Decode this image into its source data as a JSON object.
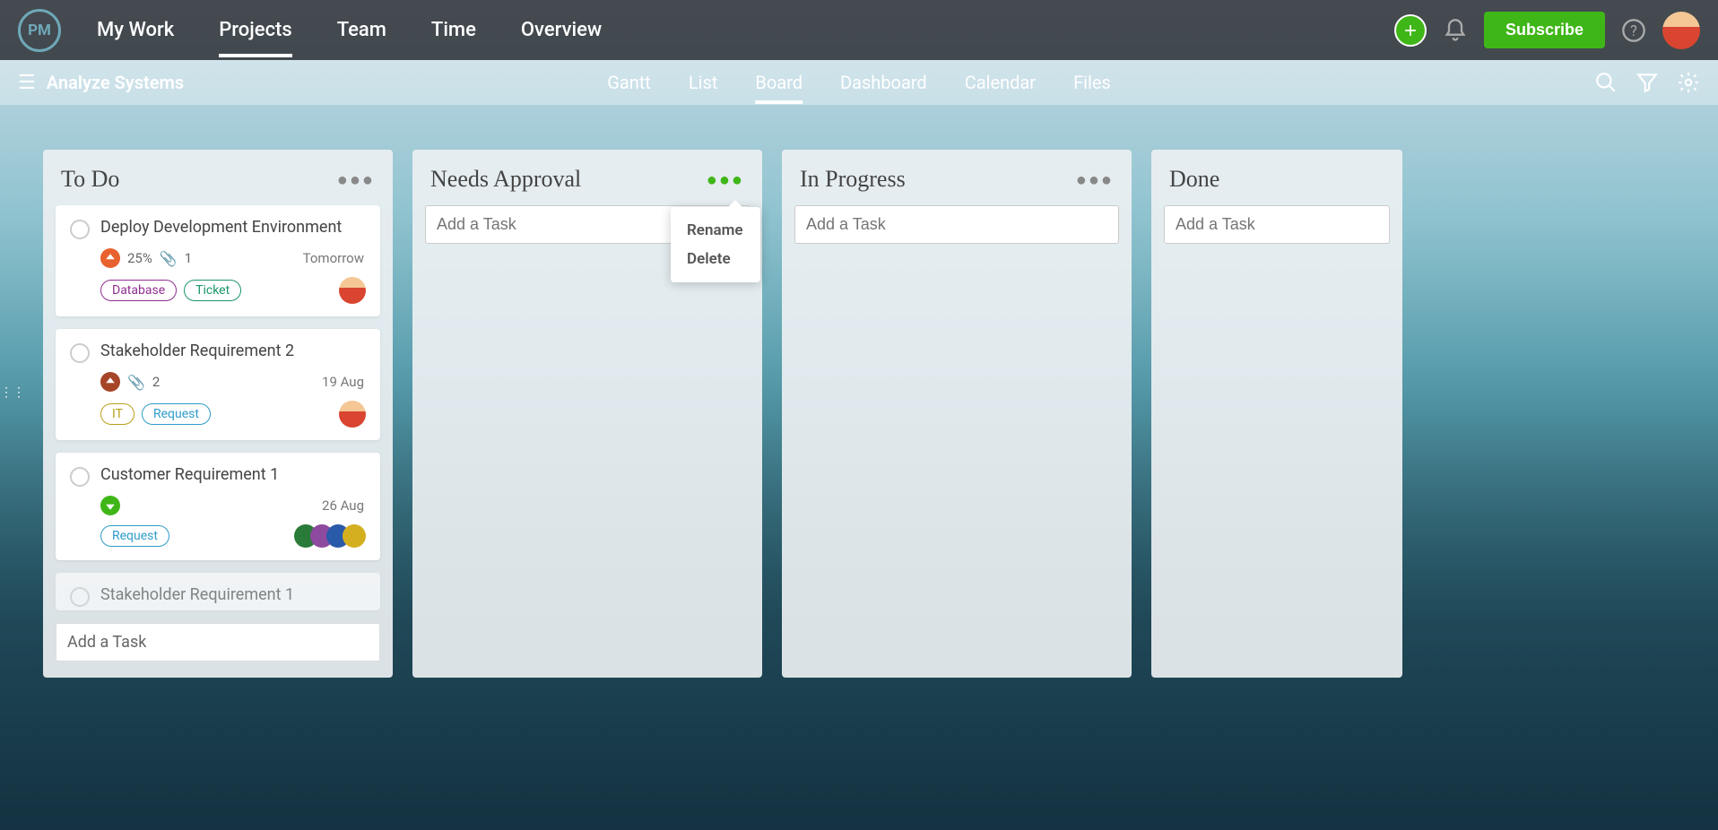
{
  "logo": "PM",
  "topnav": {
    "items": [
      "My Work",
      "Projects",
      "Team",
      "Time",
      "Overview"
    ],
    "active": 1
  },
  "subscribe_label": "Subscribe",
  "project_title": "Analyze Systems",
  "subnav": {
    "items": [
      "Gantt",
      "List",
      "Board",
      "Dashboard",
      "Calendar",
      "Files"
    ],
    "active": 2
  },
  "columns": [
    {
      "title": "To Do",
      "add_task_placeholder": "Add a Task",
      "cards": [
        {
          "title": "Deploy Development Environment",
          "priority": "high",
          "percent": "25%",
          "attachments": "1",
          "date": "Tomorrow",
          "tags": [
            "Database",
            "Ticket"
          ],
          "assignees": 1
        },
        {
          "title": "Stakeholder Requirement 2",
          "priority": "med",
          "attachments": "2",
          "date": "19 Aug",
          "tags": [
            "IT",
            "Request"
          ],
          "assignees": 1
        },
        {
          "title": "Customer Requirement 1",
          "priority": "low",
          "date": "26 Aug",
          "tags": [
            "Request"
          ],
          "assignees": 4
        },
        {
          "title": "Stakeholder Requirement 1"
        }
      ]
    },
    {
      "title": "Needs Approval",
      "add_task_placeholder": "Add a Task",
      "menu_open": true,
      "menu_items": [
        "Rename",
        "Delete"
      ]
    },
    {
      "title": "In Progress",
      "add_task_placeholder": "Add a Task"
    },
    {
      "title": "Done",
      "add_task_placeholder": "Add a Task"
    }
  ]
}
